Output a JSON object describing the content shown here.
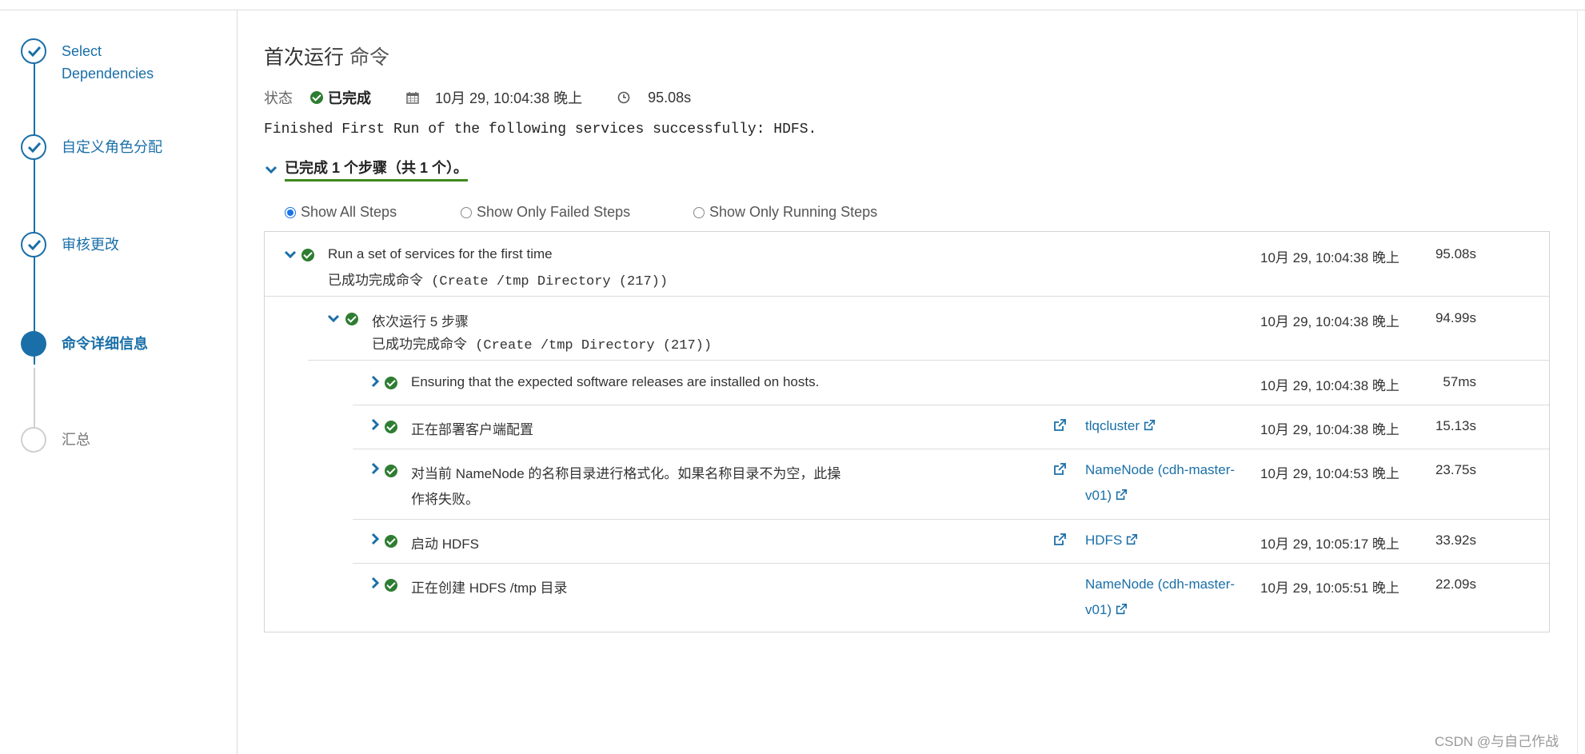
{
  "wizard": {
    "steps": [
      {
        "label": "Select\nDependencies",
        "state": "done"
      },
      {
        "label": "自定义角色分配",
        "state": "done"
      },
      {
        "label": "审核更改",
        "state": "done"
      },
      {
        "label": "命令详细信息",
        "state": "active"
      },
      {
        "label": "汇总",
        "state": "pending"
      }
    ]
  },
  "page": {
    "title": "首次运行",
    "title_suffix": "命令",
    "status_label": "状态",
    "status_value": "已完成",
    "date": "10月 29, 10:04:38 晚上",
    "duration": "95.08s",
    "message": "Finished First Run of the following services successfully: HDFS.",
    "summary": "已完成 1 个步骤（共 1 个）。"
  },
  "filters": {
    "all": "Show All Steps",
    "failed": "Show Only Failed Steps",
    "running": "Show Only Running Steps",
    "selected": "all"
  },
  "steps": {
    "root": {
      "title": "Run a set of services for the first time",
      "sub": "已成功完成命令 (Create /tmp Directory (217))",
      "time": "10月 29, 10:04:38 晚上",
      "duration": "95.08s"
    },
    "seq": {
      "title": "依次运行 5 步骤",
      "sub": "已成功完成命令 (Create /tmp Directory (217))",
      "time": "10月 29, 10:04:38 晚上",
      "duration": "94.99s"
    },
    "items": [
      {
        "title": "Ensuring that the expected software releases are installed on hosts.",
        "title2": "",
        "link": "",
        "link2": "",
        "time": "10月 29, 10:04:38 晚上",
        "duration": "57ms"
      },
      {
        "title": "正在部署客户端配置",
        "title2": "",
        "link": "tlqcluster",
        "link2": "",
        "time": "10月 29, 10:04:38 晚上",
        "duration": "15.13s"
      },
      {
        "title": "对当前 NameNode 的名称目录进行格式化。如果名称目录不为空，此操",
        "title2": "作将失败。",
        "link": "NameNode (cdh-master-",
        "link2": "v01)",
        "time": "10月 29, 10:04:53 晚上",
        "duration": "23.75s"
      },
      {
        "title": "启动 HDFS",
        "title2": "",
        "link": "HDFS",
        "link2": "",
        "time": "10月 29, 10:05:17 晚上",
        "duration": "33.92s"
      },
      {
        "title": "正在创建 HDFS /tmp 目录",
        "title2": "",
        "link": "NameNode (cdh-master-",
        "link2": "v01)",
        "time": "10月 29, 10:05:51 晚上",
        "duration": "22.09s"
      }
    ]
  },
  "watermark": "CSDN @与自己作战",
  "colors": {
    "accent": "#1a6fa8",
    "success": "#2e7d32",
    "underline": "#3c8a1c"
  }
}
